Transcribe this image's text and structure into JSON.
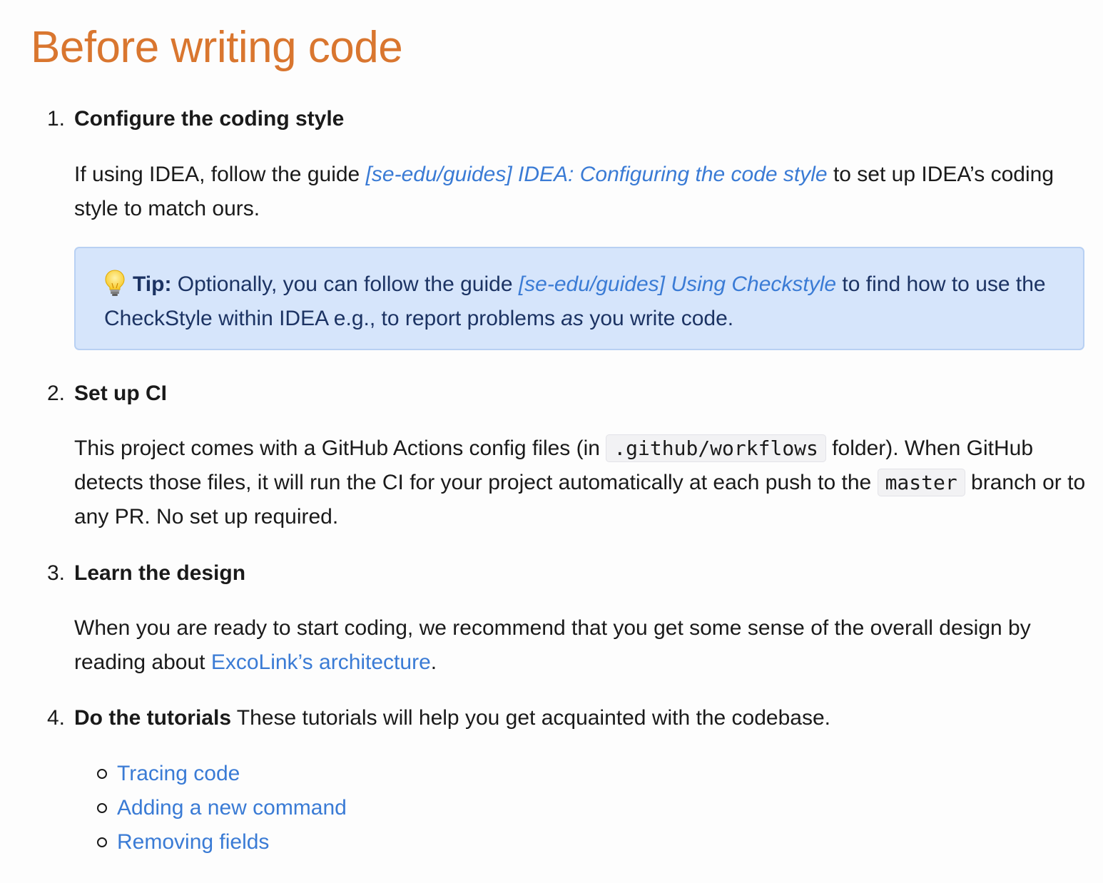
{
  "page": {
    "title": "Before writing code"
  },
  "steps": [
    {
      "number": "1.",
      "title": "Configure the coding style",
      "body": {
        "pre": "If using IDEA, follow the guide ",
        "link": "[se-edu/guides] IDEA: Configuring the code style",
        "post": " to set up IDEA’s coding style to match ours."
      },
      "tip": {
        "label": "Tip:",
        "pre": " Optionally, you can follow the guide ",
        "link": "[se-edu/guides] Using Checkstyle",
        "mid": " to find how to use the CheckStyle within IDEA e.g., to report problems ",
        "emph": "as",
        "post": " you write code."
      }
    },
    {
      "number": "2.",
      "title": "Set up CI",
      "body": {
        "pre": "This project comes with a GitHub Actions config files (in ",
        "code1": ".github/workflows",
        "mid": " folder). When GitHub detects those files, it will run the CI for your project automatically at each push to the ",
        "code2": "master",
        "post": " branch or to any PR. No set up required."
      }
    },
    {
      "number": "3.",
      "title": "Learn the design",
      "body": {
        "pre": "When you are ready to start coding, we recommend that you get some sense of the overall design by reading about ",
        "link": "ExcoLink’s architecture",
        "post": "."
      }
    },
    {
      "number": "4.",
      "title": "Do the tutorials",
      "desc": " These tutorials will help you get acquainted with the codebase.",
      "tutorials": [
        "Tracing code",
        "Adding a new command",
        "Removing fields"
      ]
    }
  ],
  "icons": {
    "tip": "lightbulb-icon",
    "bullet": "hollow-circle-bullet"
  },
  "colors": {
    "title": "#d9762f",
    "link": "#3a7bd5",
    "tip_background": "#d6e5fb",
    "tip_text": "#1c3363"
  }
}
